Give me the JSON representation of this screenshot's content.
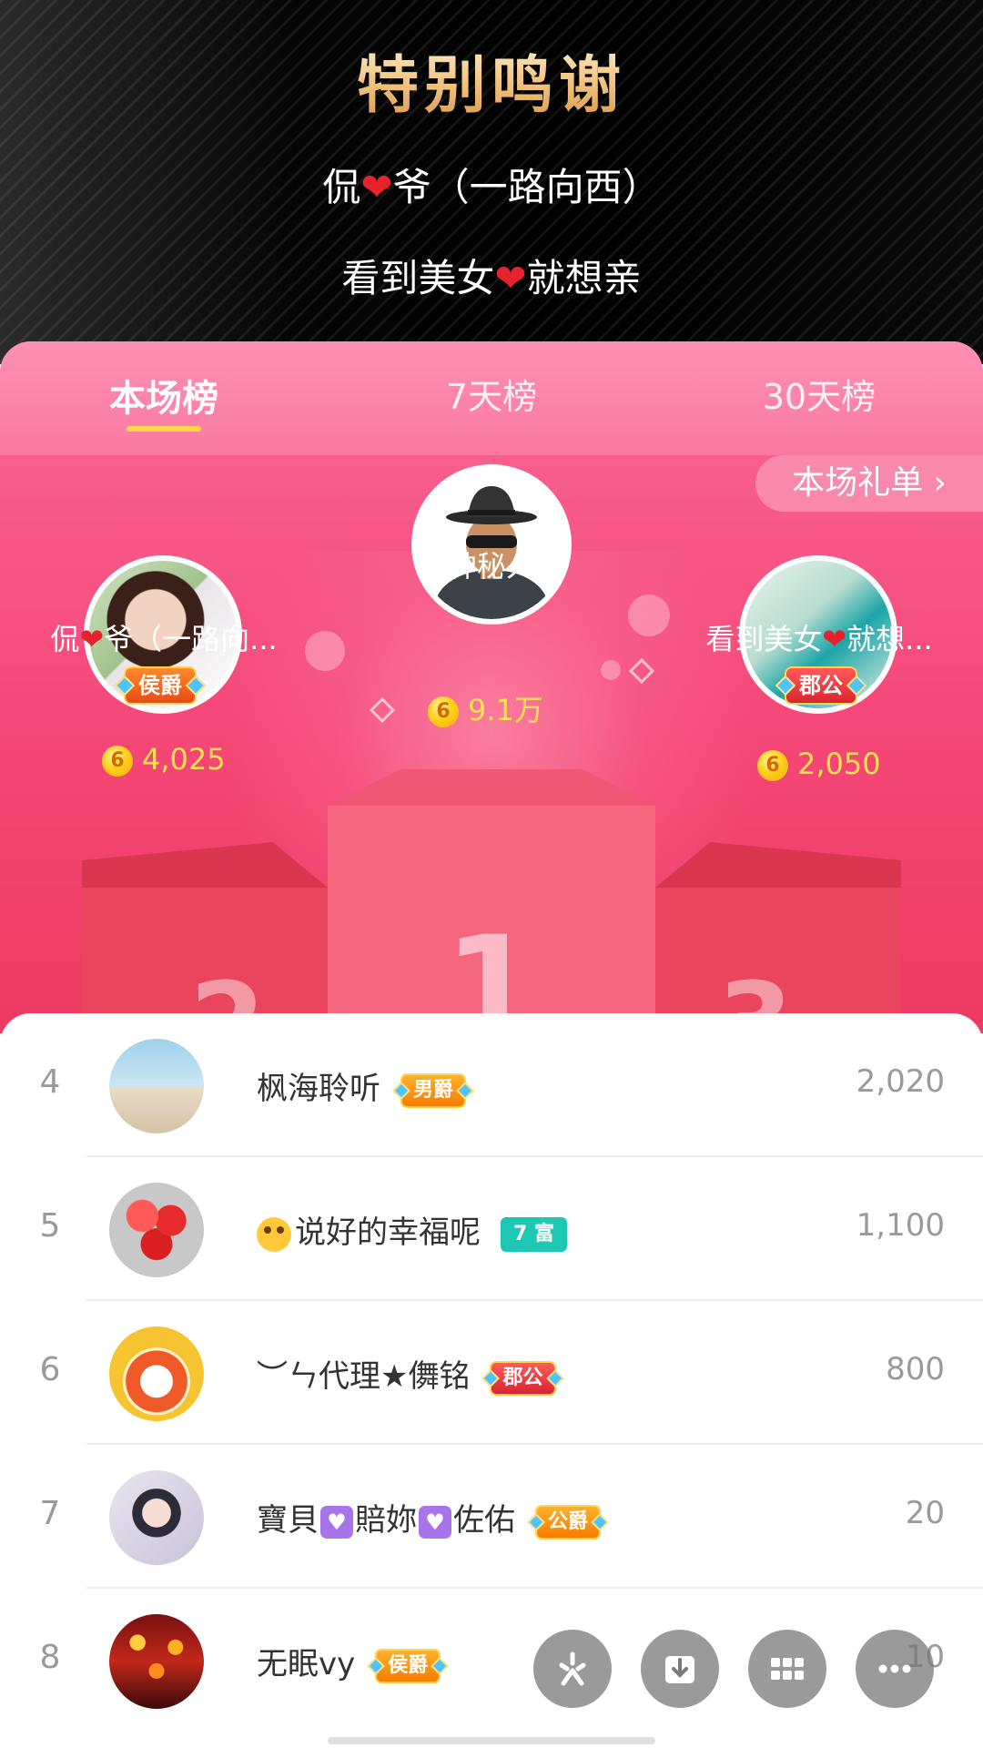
{
  "banner": {
    "title": "特别鸣谢",
    "line1_pre": "侃",
    "line1_post": "爷（一路向西）",
    "line2_pre": "看到美女",
    "line2_post": "就想亲",
    "heart_glyph": "❤"
  },
  "tabs": [
    {
      "label": "本场榜",
      "active": true
    },
    {
      "label": "7天榜",
      "active": false
    },
    {
      "label": "30天榜",
      "active": false
    }
  ],
  "gift_list_button": "本场礼单 ›",
  "top3": {
    "first": {
      "rank": "1",
      "name": "神秘人",
      "score": "9.1万"
    },
    "second": {
      "rank": "2",
      "name_pre": "侃",
      "name_post": "爷（一路向...",
      "badge": "侯爵",
      "score": "4,025"
    },
    "third": {
      "rank": "3",
      "name_pre": "看到美女",
      "name_post": "就想...",
      "badge": "郡公",
      "score": "2,050"
    }
  },
  "coin_glyph": "6",
  "list": [
    {
      "rank": "4",
      "name": "枫海聆听",
      "badge": "男爵",
      "badge_style": "orange",
      "score": "2,020"
    },
    {
      "rank": "5",
      "name": "说好的幸福呢",
      "badge": "7 富",
      "badge_style": "teal",
      "score": "1,100"
    },
    {
      "rank": "6",
      "name": "︶ㄣ代理★儛铭",
      "badge": "郡公",
      "badge_style": "red",
      "score": "800"
    },
    {
      "rank": "7",
      "name_parts": [
        "寶貝",
        "賠妳",
        "佐佑"
      ],
      "badge": "公爵",
      "badge_style": "orange",
      "score": "20"
    },
    {
      "rank": "8",
      "name": "无眠vy",
      "badge": "侯爵",
      "badge_style": "orange",
      "score": "10"
    }
  ],
  "colors": {
    "panel_pink": "#f44878",
    "tab_underline": "#ffd84a",
    "score_yellow": "#ffe14d",
    "list_text": "#333333",
    "list_muted": "#9a9a9a"
  },
  "fab_icons": [
    "sparkle-icon",
    "download-icon",
    "grid-icon",
    "more-icon"
  ]
}
